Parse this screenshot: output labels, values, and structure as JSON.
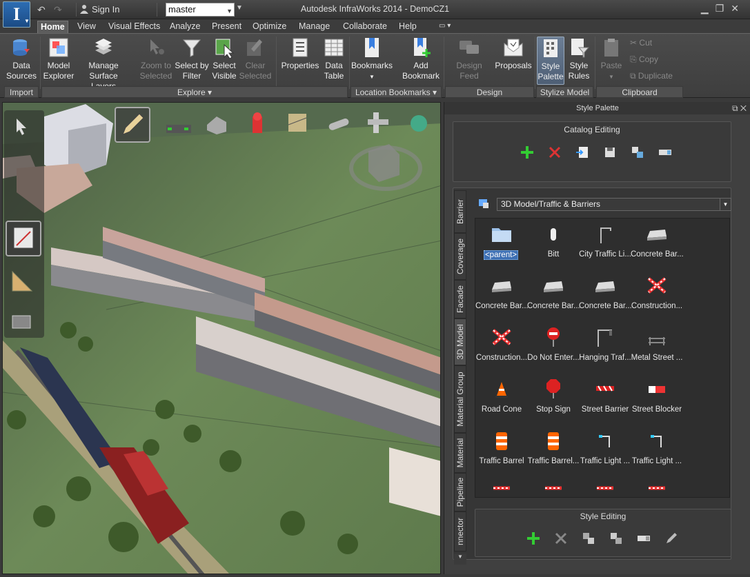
{
  "app": {
    "logo_letter": "I",
    "title": "Autodesk InfraWorks 2014 - DemoCZ1",
    "sign_in": "Sign In",
    "branch": "master"
  },
  "menu": [
    "Home",
    "View",
    "Visual Effects",
    "Analyze",
    "Present",
    "Optimize",
    "Manage",
    "Collaborate",
    "Help"
  ],
  "ribbon": {
    "buttons": [
      {
        "label1": "Data",
        "label2": "Sources",
        "enabled": true
      },
      {
        "label1": "Model",
        "label2": "Explorer",
        "enabled": true
      },
      {
        "label1": "Manage",
        "label2": "Surface Layers",
        "enabled": true
      },
      {
        "label1": "Zoom to",
        "label2": "Selected",
        "enabled": false
      },
      {
        "label1": "Select by",
        "label2": "Filter",
        "enabled": true
      },
      {
        "label1": "Select",
        "label2": "Visible",
        "enabled": true
      },
      {
        "label1": "Clear",
        "label2": "Selected",
        "enabled": false
      },
      {
        "label1": "Properties",
        "label2": "",
        "enabled": true
      },
      {
        "label1": "Data",
        "label2": "Table",
        "enabled": true
      },
      {
        "label1": "Bookmarks",
        "label2": "",
        "enabled": true
      },
      {
        "label1": "Add",
        "label2": "Bookmark",
        "enabled": true
      },
      {
        "label1": "Design Feed",
        "label2": "",
        "enabled": false
      },
      {
        "label1": "Proposals",
        "label2": "",
        "enabled": true
      },
      {
        "label1": "Style",
        "label2": "Palette",
        "enabled": true
      },
      {
        "label1": "Style",
        "label2": "Rules",
        "enabled": true
      },
      {
        "label1": "Paste",
        "label2": "",
        "enabled": false
      }
    ],
    "clipboard_small": [
      "Cut",
      "Copy",
      "Duplicate"
    ],
    "panels": [
      "Import",
      "Explore",
      "Location Bookmarks",
      "Design",
      "Stylize Model",
      "Clipboard"
    ]
  },
  "palette": {
    "title": "Style Palette",
    "catalog_editing": "Catalog Editing",
    "style_editing": "Style Editing",
    "tabs": [
      "Barrier",
      "Coverage",
      "Facade",
      "3D Model",
      "Material Group",
      "Material",
      "Pipeline",
      "nnector"
    ],
    "active_tab": "3D Model",
    "category": "3D Model/Traffic & Barriers",
    "items": [
      {
        "label": "<parent>",
        "icon": "folder-icon"
      },
      {
        "label": "Bitt",
        "icon": "bitt-icon"
      },
      {
        "label": "City Traffic Li...",
        "icon": "traffic-light-pole-icon"
      },
      {
        "label": "Concrete Bar...",
        "icon": "concrete-barrier-icon"
      },
      {
        "label": "Concrete Bar...",
        "icon": "concrete-barrier-icon"
      },
      {
        "label": "Concrete Bar...",
        "icon": "concrete-barrier-icon"
      },
      {
        "label": "Concrete Bar...",
        "icon": "concrete-barrier-icon"
      },
      {
        "label": "Construction...",
        "icon": "construction-barrier-icon"
      },
      {
        "label": "Construction...",
        "icon": "construction-barrier-icon"
      },
      {
        "label": "Do Not Enter...",
        "icon": "do-not-enter-sign-icon"
      },
      {
        "label": "Hanging Traf...",
        "icon": "hanging-traffic-light-icon"
      },
      {
        "label": "Metal Street ...",
        "icon": "metal-barrier-icon"
      },
      {
        "label": "Road Cone",
        "icon": "road-cone-icon"
      },
      {
        "label": "Stop Sign",
        "icon": "stop-sign-icon"
      },
      {
        "label": "Street Barrier",
        "icon": "street-barrier-icon"
      },
      {
        "label": "Street Blocker",
        "icon": "street-blocker-icon"
      },
      {
        "label": "Traffic Barrel",
        "icon": "traffic-barrel-icon"
      },
      {
        "label": "Traffic Barrel...",
        "icon": "traffic-barrel-icon"
      },
      {
        "label": "Traffic Light ...",
        "icon": "traffic-light-icon"
      },
      {
        "label": "Traffic Light ...",
        "icon": "traffic-light-icon"
      }
    ]
  }
}
